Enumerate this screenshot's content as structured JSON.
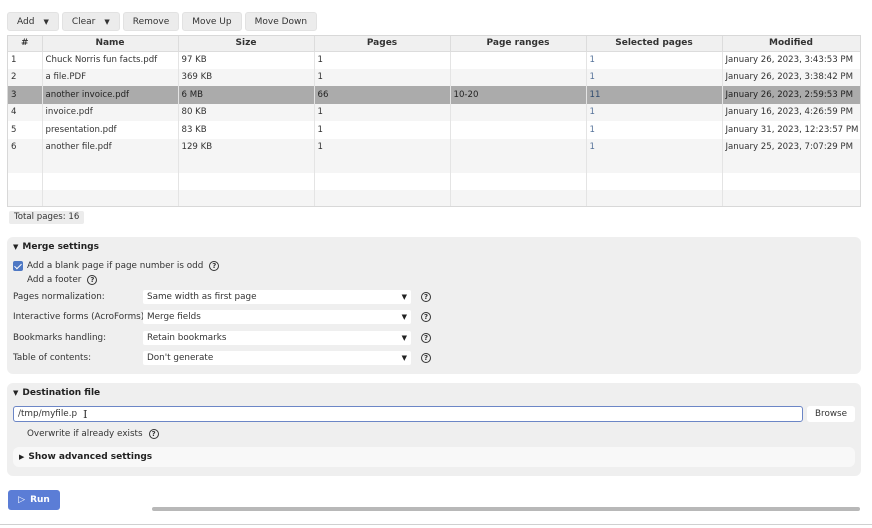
{
  "toolbar": {
    "add": "Add",
    "clear": "Clear",
    "remove": "Remove",
    "move_up": "Move Up",
    "move_down": "Move Down"
  },
  "table": {
    "columns": [
      "#",
      "Name",
      "Size",
      "Pages",
      "Page ranges",
      "Selected pages",
      "Modified"
    ],
    "rows": [
      [
        "1",
        "Chuck Norris fun facts.pdf",
        "97 KB",
        "1",
        "",
        "1",
        "January 26, 2023, 3:43:53 PM"
      ],
      [
        "2",
        "a file.PDF",
        "369 KB",
        "1",
        "",
        "1",
        "January 26, 2023, 3:38:42 PM"
      ],
      [
        "3",
        "another invoice.pdf",
        "6 MB",
        "66",
        "10-20",
        "11",
        "January 26, 2023, 2:59:53 PM"
      ],
      [
        "4",
        "invoice.pdf",
        "80 KB",
        "1",
        "",
        "1",
        "January 16, 2023, 4:26:59 PM"
      ],
      [
        "5",
        "presentation.pdf",
        "83 KB",
        "1",
        "",
        "1",
        "January 31, 2023, 12:23:57 PM"
      ],
      [
        "6",
        "another file.pdf",
        "129 KB",
        "1",
        "",
        "1",
        "January 25, 2023, 7:07:29 PM"
      ]
    ],
    "selected_row": 3
  },
  "total_pages": "Total pages: 16",
  "merge": {
    "title": "Merge settings",
    "blank_page": "Add a blank page if page number is odd",
    "blank_page_checked": true,
    "footer": "Add a footer",
    "footer_checked": false,
    "normalization_label": "Pages normalization:",
    "normalization_value": "Same width as first page",
    "forms_label": "Interactive forms (AcroForms):",
    "forms_value": "Merge fields",
    "bookmarks_label": "Bookmarks handling:",
    "bookmarks_value": "Retain bookmarks",
    "toc_label": "Table of contents:",
    "toc_value": "Don't generate"
  },
  "destination": {
    "title": "Destination file",
    "path": "/tmp/myfile.p",
    "browse": "Browse",
    "overwrite": "Overwrite if already exists",
    "overwrite_checked": false,
    "advanced": "Show advanced settings"
  },
  "run": "Run",
  "progress": 0
}
